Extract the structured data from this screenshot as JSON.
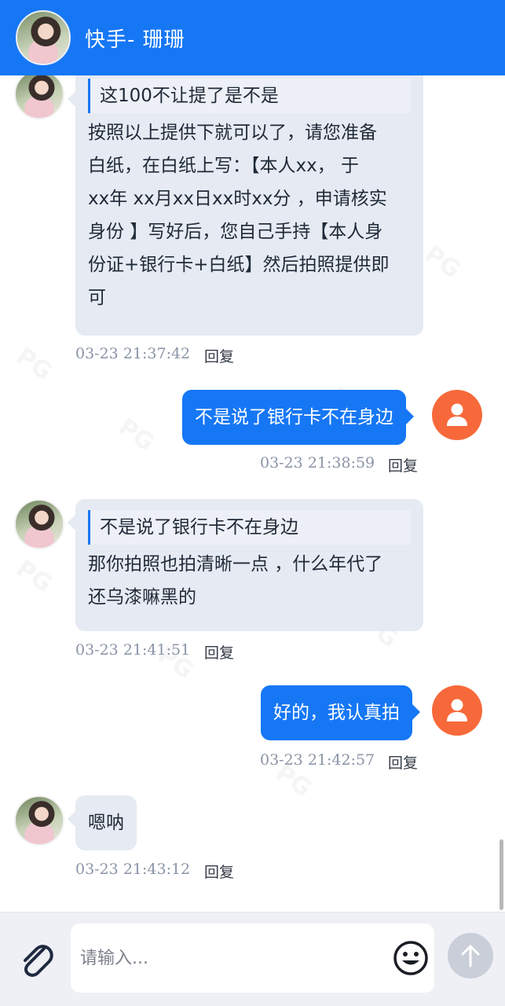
{
  "header": {
    "title": "快手- 珊珊"
  },
  "messages": [
    {
      "quote": "这100不让提了是不是",
      "text_lines": [
        "按照以上提供下就可以了，请您准备",
        "白纸，在白纸上写：【本人xx， 于",
        "xx年 xx月xx日xx时xx分 ，申请核实",
        "身份 】写好后，您自己手持【本人身",
        "份证+银行卡+白纸】然后拍照提供即",
        "可"
      ],
      "time": "03-23 21:37:42",
      "reply": "回复"
    },
    {
      "text": "不是说了银行卡不在身边",
      "time": "03-23 21:38:59",
      "reply": "回复"
    },
    {
      "quote": "不是说了银行卡不在身边",
      "text_lines": [
        "那你拍照也拍清晰一点 ，什么年代了",
        "还乌漆嘛黑的"
      ],
      "time": "03-23 21:41:51",
      "reply": "回复"
    },
    {
      "text": "好的，我认真拍",
      "time": "03-23 21:42:57",
      "reply": "回复"
    },
    {
      "text": "嗯呐",
      "time": "03-23 21:43:12",
      "reply": "回复"
    }
  ],
  "input": {
    "placeholder": "请输入..."
  },
  "icons": {
    "attach": "paperclip-icon",
    "emoji": "smiley-icon",
    "send": "arrow-up-icon",
    "user": "person-icon"
  },
  "colors": {
    "brand": "#1677f5",
    "user_avatar": "#f7693a",
    "incoming_bubble": "#e6eaf2"
  }
}
